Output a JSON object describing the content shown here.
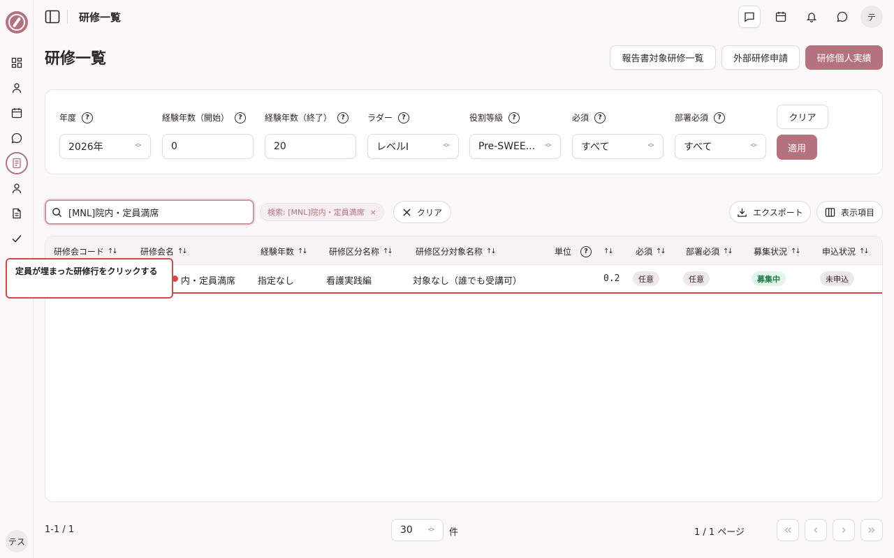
{
  "header": {
    "title": "研修一覧",
    "avatar": "テ"
  },
  "sidebar": {
    "user_avatar": "テス"
  },
  "page": {
    "title": "研修一覧",
    "actions": {
      "report_target": "報告書対象研修一覧",
      "external_apply": "外部研修申請",
      "personal_record": "研修個人実績"
    }
  },
  "filters": {
    "year": {
      "label": "年度",
      "value": "2026年"
    },
    "exp_start": {
      "label": "経験年数（開始）",
      "value": "0"
    },
    "exp_end": {
      "label": "経験年数（終了）",
      "value": "20"
    },
    "ladder": {
      "label": "ラダー",
      "value": "レベルI"
    },
    "role_grade": {
      "label": "役割等級",
      "value": "Pre-SWEE..."
    },
    "required": {
      "label": "必須",
      "value": "すべて"
    },
    "dept_required": {
      "label": "部署必須",
      "value": "すべて"
    },
    "clear_label": "クリア",
    "apply_label": "適用"
  },
  "search": {
    "value": "[MNL]院内・定員満席",
    "chip_label": "検索: [MNL]院内・定員満席",
    "chip_close": "×",
    "clear_label": "クリア",
    "export_label": "エクスポート",
    "columns_label": "表示項目"
  },
  "table": {
    "headers": {
      "code": "研修会コード",
      "name": "研修会名",
      "experience": "経験年数",
      "category": "研修区分名称",
      "category_target": "研修区分対象名称",
      "unit": "単位",
      "required": "必須",
      "dept_required": "部署必須",
      "recruit_status": "募集状況",
      "apply_status": "申込状況"
    },
    "rows": [
      {
        "name": "[MNL]院内・定員満席",
        "name_visible": "内・定員満席",
        "experience": "指定なし",
        "category": "看護実践編",
        "category_target": "対象なし（誰でも受講可）",
        "unit": "0.2",
        "required": "任意",
        "dept_required": "任意",
        "recruit_status": "募集中",
        "apply_status": "未申込"
      }
    ]
  },
  "tooltip": {
    "text": "定員が埋まった研修行をクリックする"
  },
  "footer": {
    "count": "1-1 / 1",
    "per_page": "30",
    "per_page_unit": "件",
    "page_info": "1 / 1 ページ"
  },
  "colors": {
    "accent": "#b3727d",
    "highlight": "#d14a4a"
  }
}
